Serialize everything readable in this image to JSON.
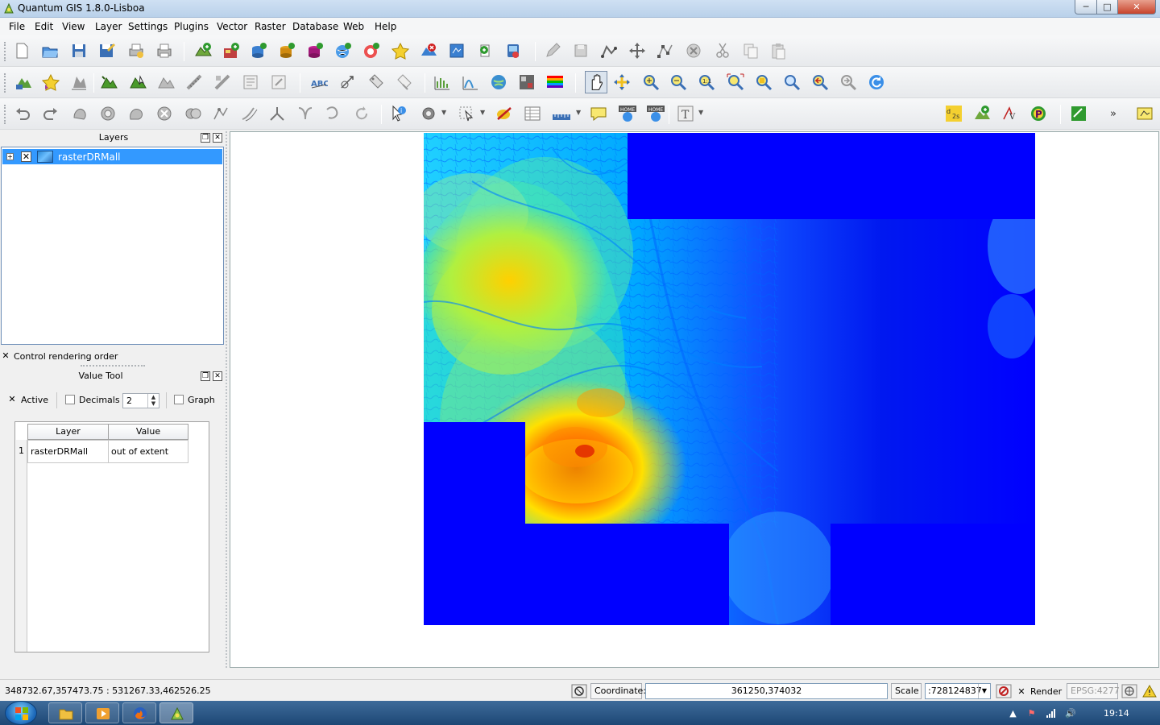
{
  "window": {
    "title": "Quantum GIS 1.8.0-Lisboa",
    "controls": {
      "minimize": "─",
      "maximize": "□",
      "close": "✕"
    }
  },
  "menubar": {
    "items": [
      "File",
      "Edit",
      "View",
      "Layer",
      "Settings",
      "Plugins",
      "Vector",
      "Raster",
      "Database",
      "Web",
      "Help"
    ]
  },
  "toolbars": {
    "overflow_label": "»"
  },
  "layers_panel": {
    "title": "Layers",
    "layers": [
      {
        "name": "rasterDRMall",
        "visible": true,
        "selected": true
      }
    ],
    "control_rendering_order": {
      "label": "Control rendering order",
      "checked": true
    }
  },
  "value_tool": {
    "title": "Value Tool",
    "active": {
      "label": "Active",
      "checked": true
    },
    "decimals": {
      "label": "Decimals",
      "checked": false,
      "value": "2"
    },
    "graph": {
      "label": "Graph",
      "checked": false
    },
    "table": {
      "headers": [
        "Layer",
        "Value"
      ],
      "rows": [
        {
          "num": "1",
          "layer": "rasterDRMall",
          "value": "out of extent"
        }
      ]
    }
  },
  "statusbar": {
    "extent": "348732.67,357473.75 : 531267.33,462526.25",
    "coordinate_label": "Coordinate:",
    "coordinate_value": "361250,374032",
    "scale_label": "Scale",
    "scale_value": ":728124837",
    "render_label": "Render",
    "render_checked": true,
    "crs": "EPSG:4277"
  },
  "taskbar": {
    "time": "19:14"
  },
  "colors": {
    "selection": "#3399ff",
    "nodata": "#0000ff",
    "canvas_bg": "#ffffff"
  }
}
